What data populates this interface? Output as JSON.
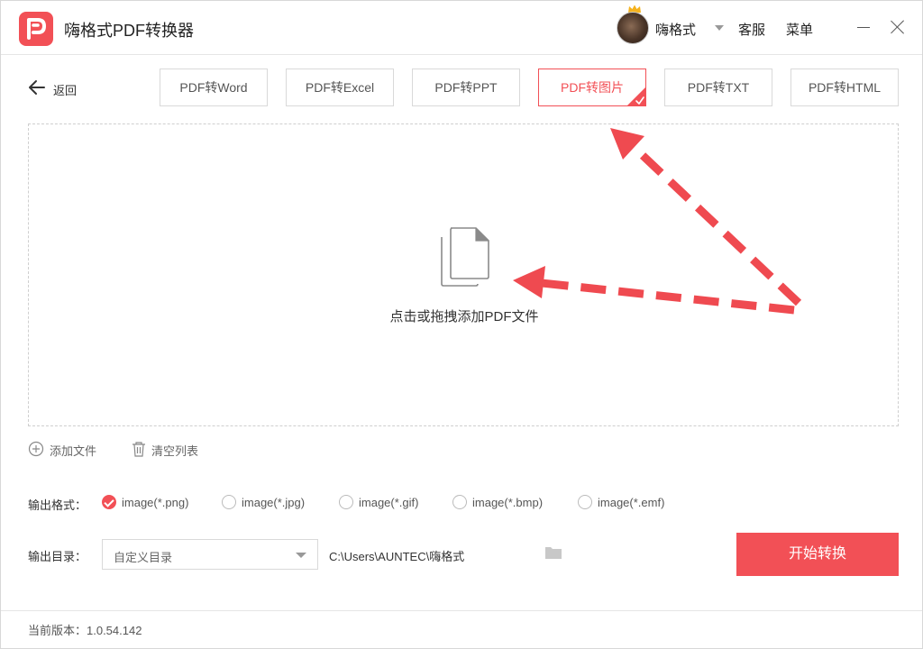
{
  "app": {
    "title": "嗨格式PDF转换器",
    "accent_color": "#f25056",
    "logo_icon": "pdf-p-logo-icon"
  },
  "header": {
    "username": "嗨格式",
    "service": "客服",
    "menu": "菜单"
  },
  "nav": {
    "back_label": "返回"
  },
  "tabs": [
    {
      "label": "PDF转Word",
      "active": false
    },
    {
      "label": "PDF转Excel",
      "active": false
    },
    {
      "label": "PDF转PPT",
      "active": false
    },
    {
      "label": "PDF转图片",
      "active": true
    },
    {
      "label": "PDF转TXT",
      "active": false
    },
    {
      "label": "PDF转HTML",
      "active": false
    }
  ],
  "dropzone": {
    "hint": "点击或拖拽添加PDF文件",
    "icon": "document-icon"
  },
  "list_actions": {
    "add_file": "添加文件",
    "clear_list": "清空列表"
  },
  "output_format": {
    "label": "输出格式：",
    "options": [
      {
        "label": "image(*.png)",
        "checked": true
      },
      {
        "label": "image(*.jpg)",
        "checked": false
      },
      {
        "label": "image(*.gif)",
        "checked": false
      },
      {
        "label": "image(*.bmp)",
        "checked": false
      },
      {
        "label": "image(*.emf)",
        "checked": false
      }
    ]
  },
  "output_dir": {
    "label": "输出目录：",
    "selected": "自定义目录",
    "path": "C:\\Users\\AUNTEC\\嗨格式"
  },
  "actions": {
    "start": "开始转换"
  },
  "footer": {
    "version": "当前版本：1.0.54.142"
  }
}
